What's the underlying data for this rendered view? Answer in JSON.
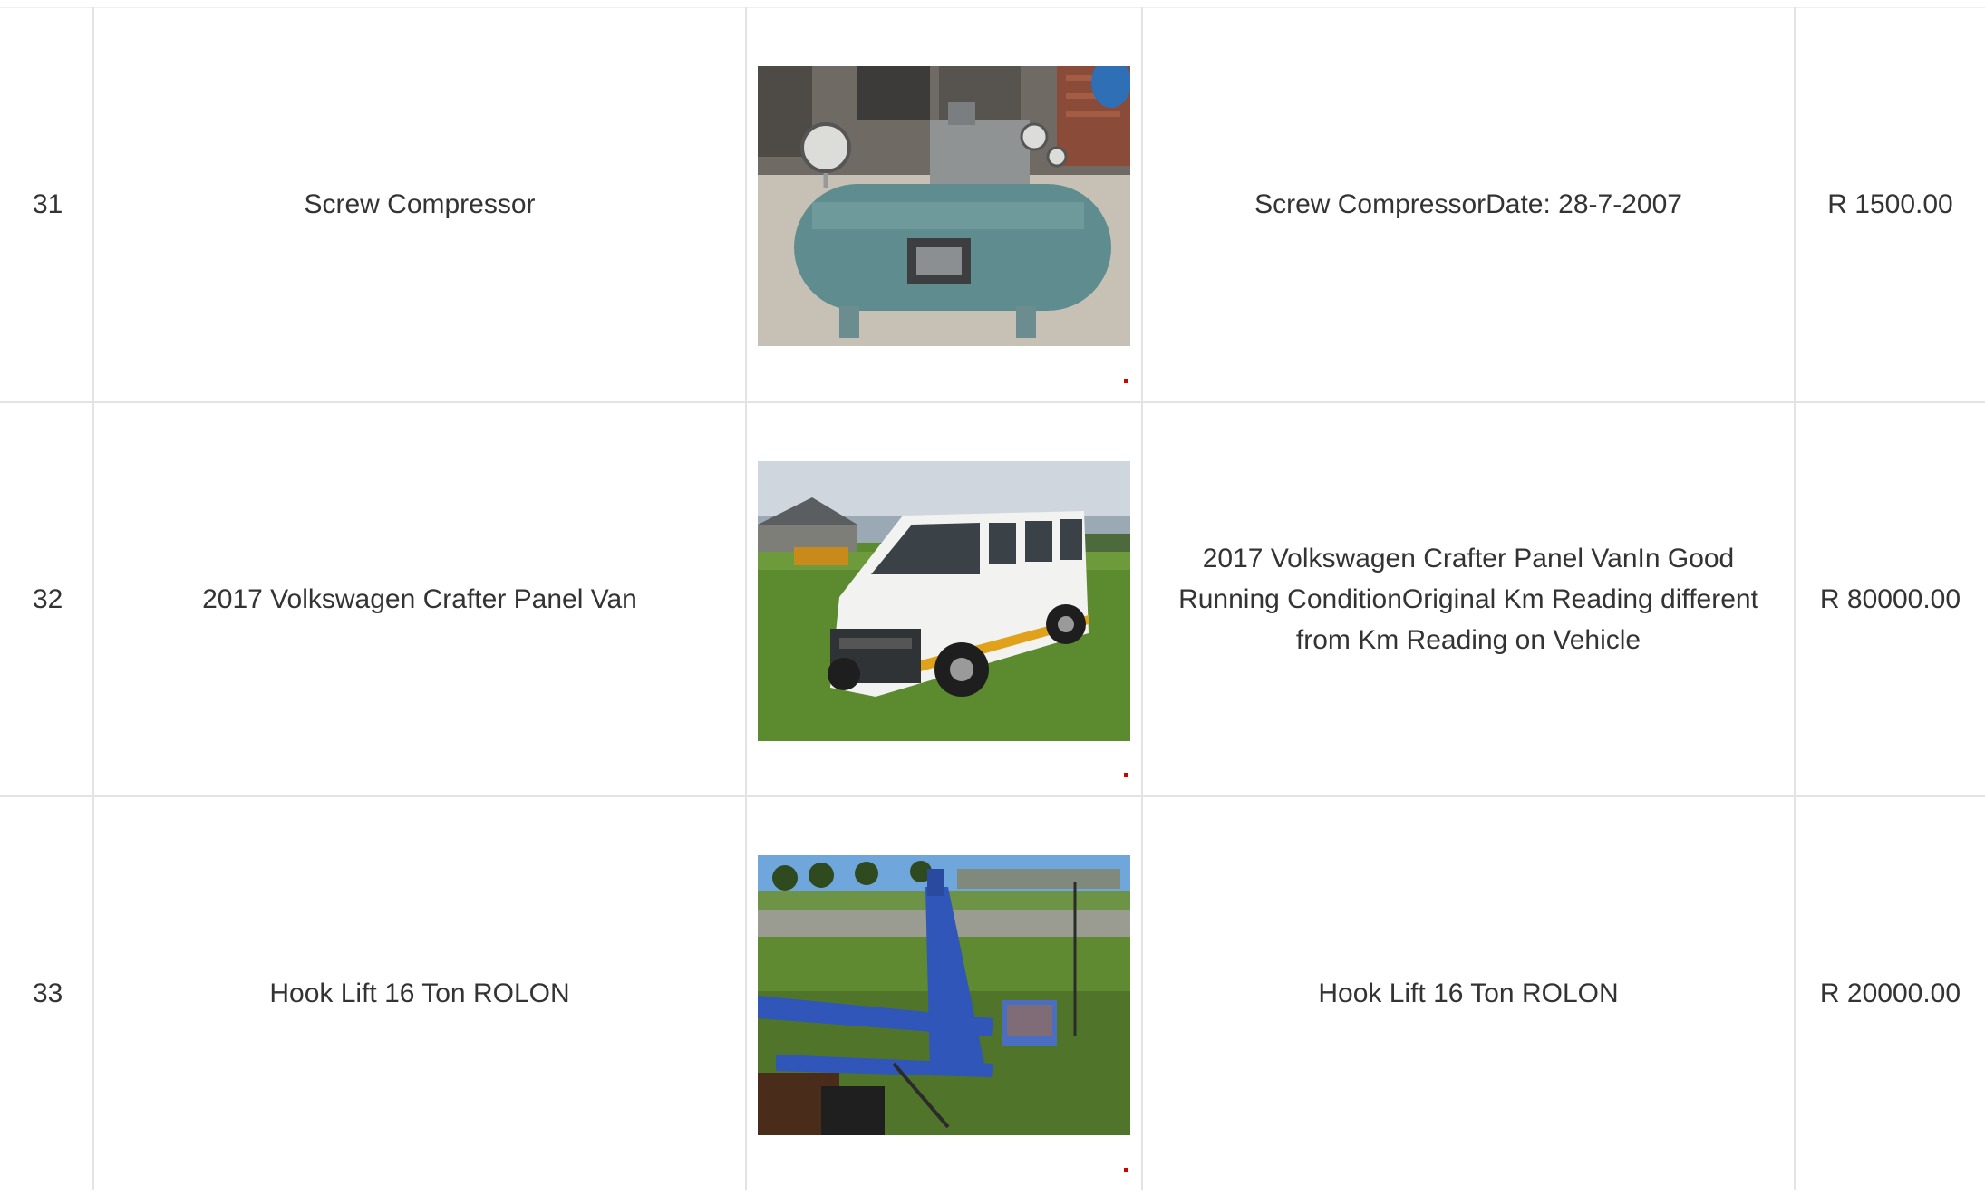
{
  "rows": [
    {
      "number": "31",
      "name": "Screw Compressor",
      "image_icon": "air-compressor-photo",
      "description": "Screw CompressorDate: 28-7-2007",
      "price": "R 1500.00"
    },
    {
      "number": "32",
      "name": "2017 Volkswagen Crafter Panel Van",
      "image_icon": "white-van-photo",
      "description": "2017 Volkswagen Crafter Panel VanIn Good Running ConditionOriginal Km Reading different from Km Reading on Vehicle",
      "price": "R 80000.00"
    },
    {
      "number": "33",
      "name": "Hook Lift 16 Ton ROLON",
      "image_icon": "hook-lift-photo",
      "description": "Hook Lift 16 Ton ROLON",
      "price": "R 20000.00"
    }
  ],
  "colors": {
    "border": "#e3e3e3",
    "text": "#333333",
    "marker": "#d40000"
  }
}
